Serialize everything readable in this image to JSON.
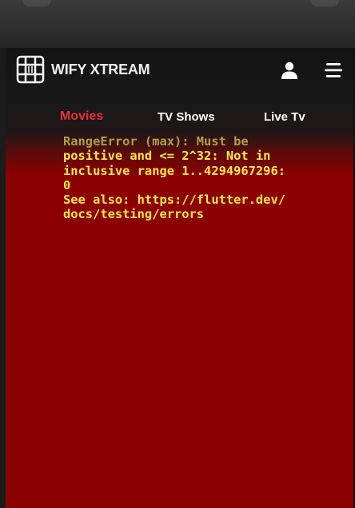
{
  "app": {
    "brand_name": "WIFY XTREAM"
  },
  "header": {
    "logo_icon": "film-grid-icon",
    "user_icon": "user-icon",
    "menu_icon": "menu-icon"
  },
  "tabs": [
    {
      "label": "Movies",
      "active": true
    },
    {
      "label": "TV Shows",
      "active": false
    },
    {
      "label": "Live Tv",
      "active": false
    }
  ],
  "error": {
    "line1": "RangeError (max): Must be",
    "rest": "positive and <= 2^32: Not in\ninclusive range 1..4294967296:\n0\nSee also: https://flutter.dev/\ndocs/testing/errors"
  },
  "colors": {
    "active_tab": "#e5323b",
    "error_text": "#ffe84a",
    "error_background": "#8b0000",
    "header_background": "#181818"
  }
}
